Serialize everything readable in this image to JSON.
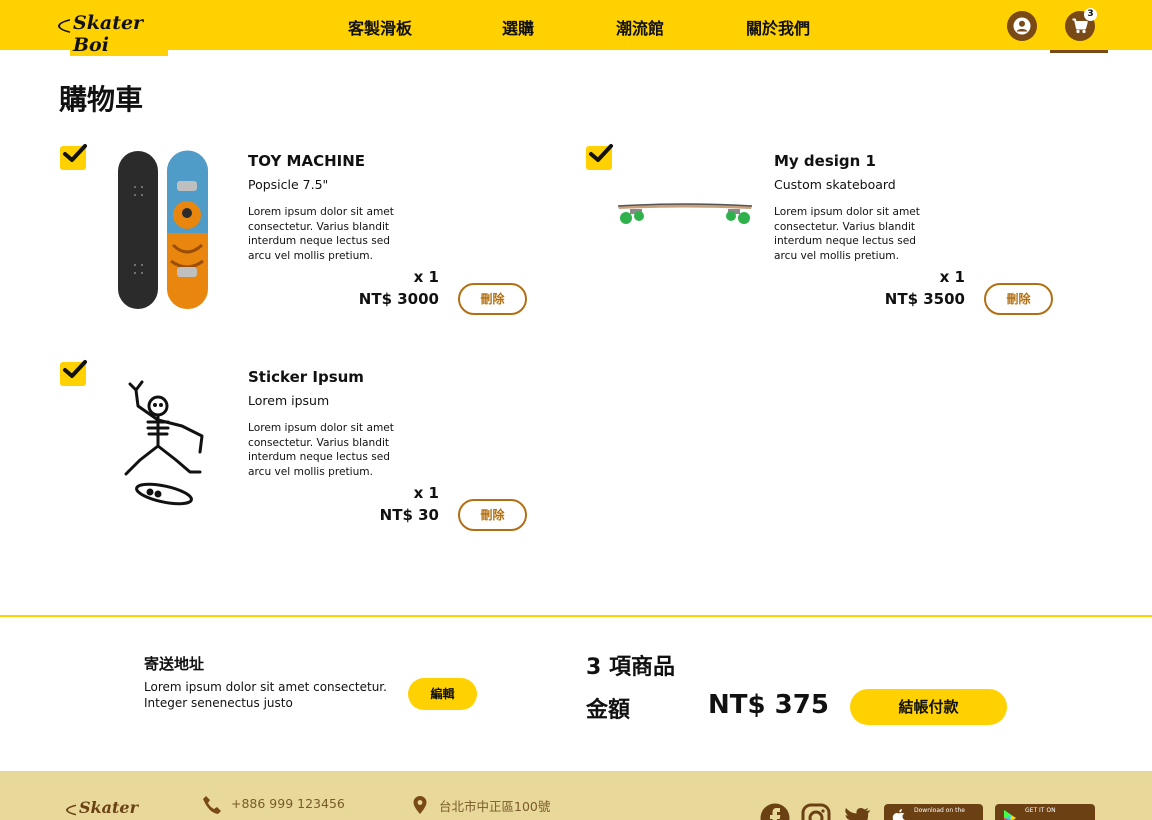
{
  "header": {
    "logo_text": "Skater Boi",
    "nav": [
      "客製滑板",
      "選購",
      "潮流館",
      "關於我們"
    ],
    "cart_count": "3"
  },
  "page_title": "購物車",
  "items": [
    {
      "checked": true,
      "name": "TOY MACHINE",
      "subtitle": "Popsicle 7.5\"",
      "description": "Lorem ipsum dolor sit amet consectetur. Varius blandit interdum neque lectus sed arcu vel mollis pretium.",
      "qty": "x 1",
      "price": "NT$  3000",
      "delete_label": "刪除",
      "image": "skateboard-deck-image"
    },
    {
      "checked": true,
      "name": "My design 1",
      "subtitle": "Custom skateboard",
      "description": "Lorem ipsum dolor sit amet consectetur. Varius blandit interdum neque lectus sed arcu vel mollis pretium.",
      "qty": "x 1",
      "price": "NT$  3500",
      "delete_label": "刪除",
      "image": "longboard-side-image"
    },
    {
      "checked": true,
      "name": "Sticker Ipsum",
      "subtitle": "Lorem ipsum",
      "description": "Lorem ipsum dolor sit amet consectetur. Varius blandit interdum neque lectus sed arcu vel mollis pretium.",
      "qty": "x 1",
      "price": "NT$  30",
      "delete_label": "刪除",
      "image": "skeleton-sticker-image"
    }
  ],
  "shipping": {
    "title": "寄送地址",
    "address": "Lorem ipsum dolor sit amet consectetur. Integer senenectus justo",
    "edit_label": "編輯"
  },
  "summary": {
    "count_label": "3 項商品",
    "amount_label": "金額",
    "total": "NT$  375",
    "checkout_label": "結帳付款"
  },
  "footer": {
    "logo_text": "Skater Boi",
    "phone": "+886 999 123456",
    "address": "台北市中正區100號",
    "app_store_label": "Download on the",
    "google_play_label": "GET IT ON"
  },
  "colors": {
    "brand_yellow": "#ffd100",
    "brand_brown": "#7a4a16",
    "footer_bg": "#e8d99a"
  }
}
